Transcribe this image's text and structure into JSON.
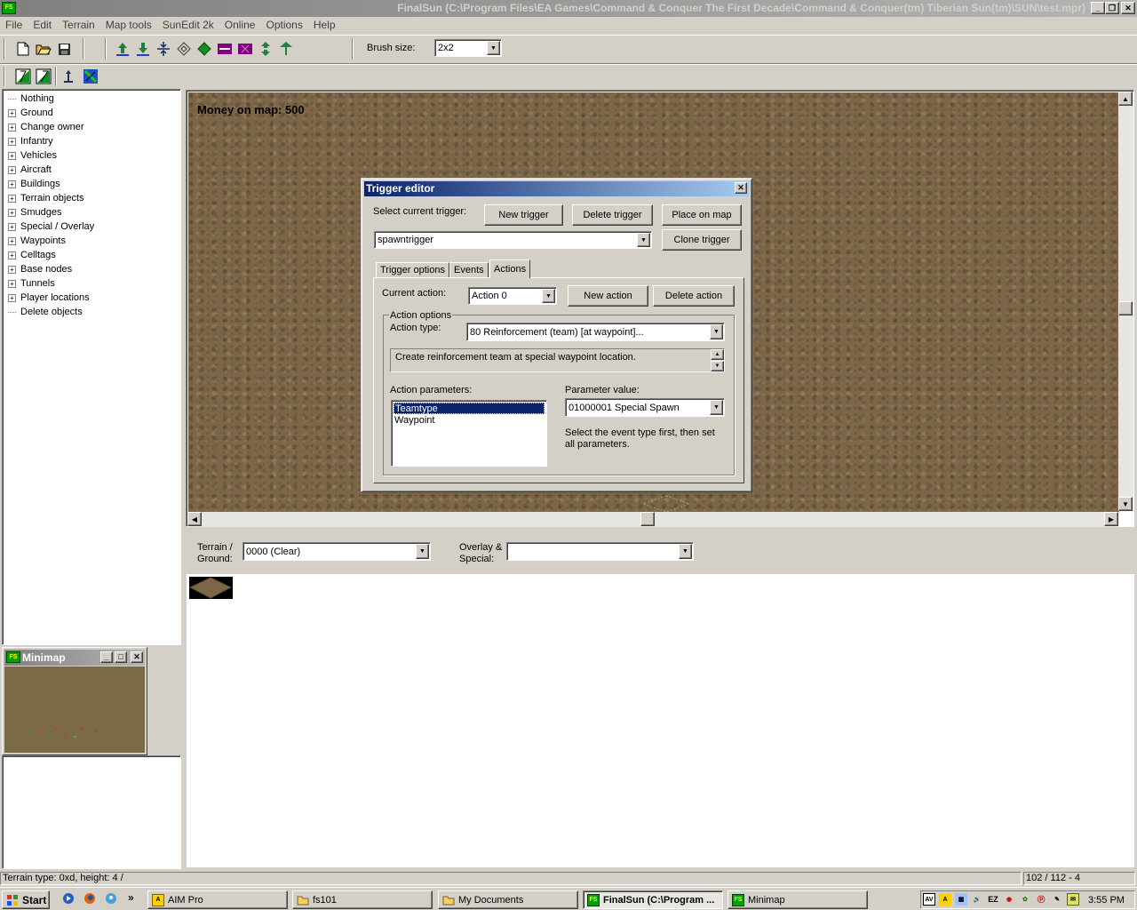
{
  "window": {
    "title": "FinalSun (C:\\Program Files\\EA Games\\Command & Conquer The First Decade\\Command & Conquer(tm) Tiberian Sun(tm)\\SUN\\test.mpr)",
    "app_icon": "FS"
  },
  "menu": [
    "File",
    "Edit",
    "Terrain",
    "Map tools",
    "SunEdit 2k",
    "Online",
    "Options",
    "Help"
  ],
  "toolbar": {
    "brush_label": "Brush size:",
    "brush_value": "2x2"
  },
  "tree": {
    "items": [
      {
        "label": "Nothing",
        "expandable": false
      },
      {
        "label": "Ground",
        "expandable": true
      },
      {
        "label": "Change owner",
        "expandable": true
      },
      {
        "label": "Infantry",
        "expandable": true
      },
      {
        "label": "Vehicles",
        "expandable": true
      },
      {
        "label": "Aircraft",
        "expandable": true
      },
      {
        "label": "Buildings",
        "expandable": true
      },
      {
        "label": "Terrain objects",
        "expandable": true
      },
      {
        "label": "Smudges",
        "expandable": true
      },
      {
        "label": "Special / Overlay",
        "expandable": true
      },
      {
        "label": "Waypoints",
        "expandable": true
      },
      {
        "label": "Celltags",
        "expandable": true
      },
      {
        "label": "Base nodes",
        "expandable": true
      },
      {
        "label": "Tunnels",
        "expandable": true
      },
      {
        "label": "Player locations",
        "expandable": true
      },
      {
        "label": "Delete objects",
        "expandable": false
      }
    ]
  },
  "map": {
    "money_text": "Money on map: 500"
  },
  "trigger_editor": {
    "title": "Trigger editor",
    "select_label": "Select current trigger:",
    "new_trigger": "New trigger",
    "delete_trigger": "Delete trigger",
    "place_on_map": "Place on map",
    "clone_trigger": "Clone trigger",
    "current_trigger": "spawntrigger",
    "tabs": [
      "Trigger options",
      "Events",
      "Actions"
    ],
    "active_tab": "Actions",
    "current_action_label": "Current action:",
    "current_action": "Action 0",
    "new_action": "New action",
    "delete_action": "Delete action",
    "action_options_label": "Action options",
    "action_type_label": "Action type:",
    "action_type": "80 Reinforcement (team) [at waypoint]...",
    "description": "Create reinforcement team at special waypoint location.",
    "params_label": "Action parameters:",
    "params": [
      "Teamtype",
      "Waypoint"
    ],
    "selected_param": "Teamtype",
    "param_value_label": "Parameter value:",
    "param_value": "01000001 Special Spawn",
    "hint": "Select the event type first, then set all parameters."
  },
  "terrain_panel": {
    "terrain_label_1": "Terrain /",
    "terrain_label_2": "Ground:",
    "terrain_value": "0000 (Clear)",
    "overlay_label_1": "Overlay &",
    "overlay_label_2": "Special:",
    "overlay_value": ""
  },
  "minimap": {
    "title": "Minimap"
  },
  "status": {
    "left": "Terrain type: 0xd, height: 4 /",
    "right": "102 / 112 - 4"
  },
  "taskbar": {
    "start": "Start",
    "tasks": [
      "AIM Pro",
      "fs101",
      "My Documents",
      "FinalSun (C:\\Program ...",
      "Minimap"
    ],
    "active_task": "FinalSun (C:\\Program ...",
    "clock": "3:55 PM",
    "chevron": "»"
  },
  "colors": {
    "dialog_title": "#0a246a",
    "selection": "#0a246a",
    "map_ground": "#7d6648",
    "desktop_face": "#d4d0c8"
  }
}
